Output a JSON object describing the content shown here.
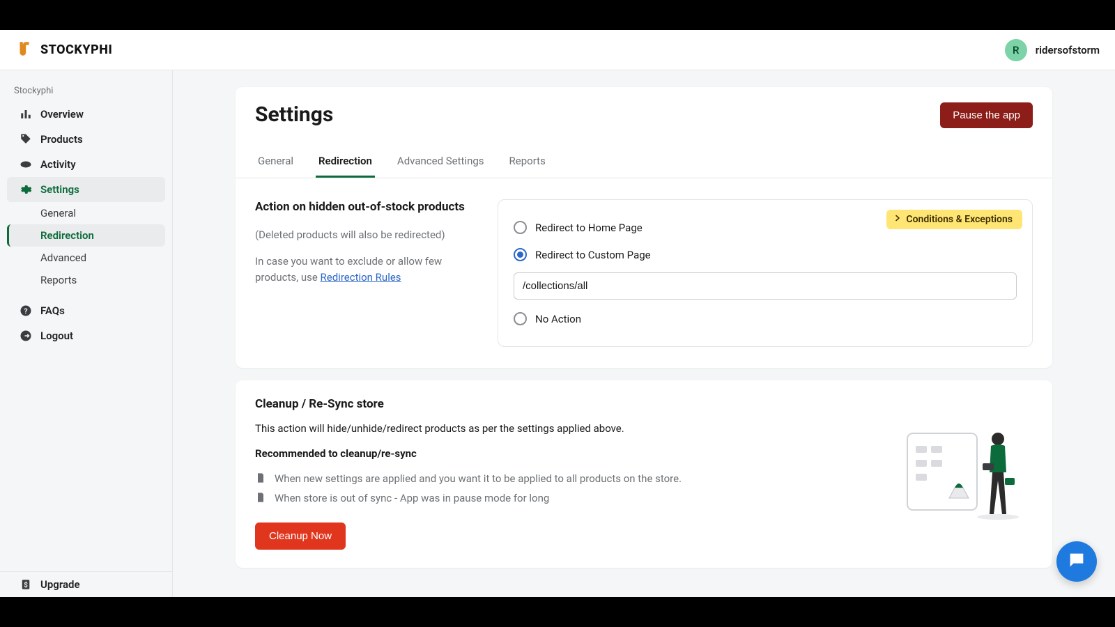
{
  "brand": {
    "name": "STOCKYPHI"
  },
  "user": {
    "initial": "R",
    "name": "ridersofstorm"
  },
  "sidebar": {
    "title": "Stockyphi",
    "items": [
      {
        "label": "Overview",
        "icon": "chart-bar-icon"
      },
      {
        "label": "Products",
        "icon": "tag-icon"
      },
      {
        "label": "Activity",
        "icon": "activity-icon"
      },
      {
        "label": "Settings",
        "icon": "gear-icon"
      }
    ],
    "sub": [
      {
        "label": "General"
      },
      {
        "label": "Redirection"
      },
      {
        "label": "Advanced"
      },
      {
        "label": "Reports"
      }
    ],
    "items2": [
      {
        "label": "FAQs",
        "icon": "question-icon"
      },
      {
        "label": "Logout",
        "icon": "logout-icon"
      }
    ],
    "bottom": {
      "label": "Upgrade",
      "icon": "dollar-icon"
    }
  },
  "page": {
    "title": "Settings",
    "pause_btn": "Pause the app",
    "tabs": [
      {
        "label": "General"
      },
      {
        "label": "Redirection"
      },
      {
        "label": "Advanced Settings"
      },
      {
        "label": "Reports"
      }
    ]
  },
  "redir": {
    "heading": "Action on hidden out-of-stock products",
    "note": "(Deleted products will also be redirected)",
    "exclude_prefix": "In case you want to exclude or allow few products, use ",
    "exclude_link": "Redirection Rules",
    "conditions_label": "Conditions & Exceptions",
    "opt_home": "Redirect to Home Page",
    "opt_custom": "Redirect to Custom Page",
    "custom_url": "/collections/all",
    "opt_none": "No Action"
  },
  "cleanup": {
    "heading": "Cleanup / Re-Sync store",
    "desc": "This action will hide/unhide/redirect products as per the settings applied above.",
    "rec_heading": "Recommended to cleanup/re-sync",
    "rec1": "When new settings are applied and you want it to be applied to all products on the store.",
    "rec2": "When store is out of sync - App was in pause mode for long",
    "btn": "Cleanup Now"
  }
}
